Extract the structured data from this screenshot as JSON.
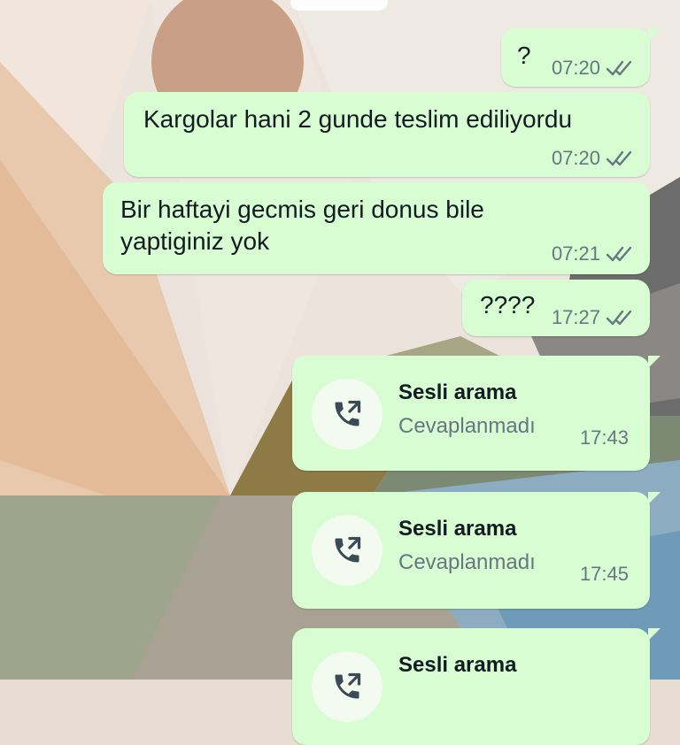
{
  "messages": [
    {
      "text": "?",
      "time": "07:20",
      "status": "read"
    },
    {
      "text": "Kargolar hani 2 gunde teslim ediliyordu",
      "time": "07:20",
      "status": "read"
    },
    {
      "text_line1": "Bir haftayi gecmis geri donus bile",
      "text_line2": "yaptiginiz yok",
      "time": "07:21",
      "status": "read"
    },
    {
      "text": "????",
      "time": "17:27",
      "status": "read"
    }
  ],
  "calls": [
    {
      "title": "Sesli arama",
      "subtitle": "Cevaplanmadı",
      "time": "17:43",
      "icon": "outgoing-call-icon"
    },
    {
      "title": "Sesli arama",
      "subtitle": "Cevaplanmadı",
      "time": "17:45",
      "icon": "outgoing-call-icon"
    },
    {
      "title": "Sesli arama",
      "icon": "outgoing-call-icon"
    }
  ],
  "colors": {
    "bubble": "#d9fdd3",
    "time_text": "#667781",
    "primary_text": "#111b21"
  }
}
